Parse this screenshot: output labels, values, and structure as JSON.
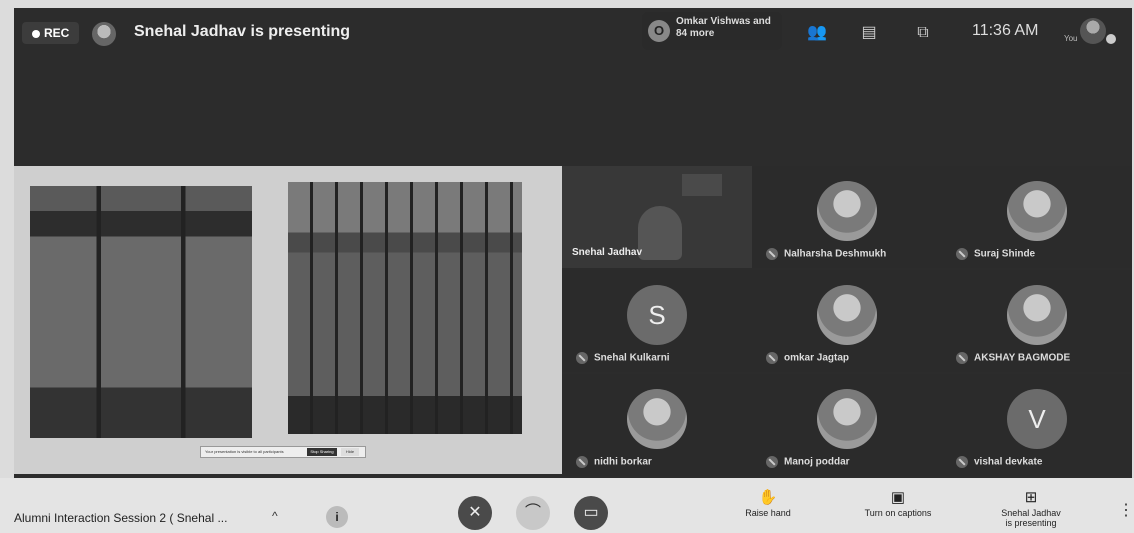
{
  "top": {
    "rec_label": "REC",
    "presenting_text": "Snehal Jadhav is presenting",
    "people_initial": "O",
    "people_text": "Omkar Vishwas and 84 more",
    "clock": "11:36 AM",
    "you_label": "You"
  },
  "shared": {
    "hint_text": "Your presentation is visible to all participants",
    "hint_btn1": "Stop Sharing",
    "hint_btn2": "Hide"
  },
  "participants": [
    {
      "name": "Snehal Jadhav"
    },
    {
      "name": "Nalharsha Deshmukh"
    },
    {
      "name": "Suraj Shinde"
    },
    {
      "name": "Snehal Kulkarni",
      "initial": "S"
    },
    {
      "name": "omkar Jagtap"
    },
    {
      "name": "AKSHAY BAGMODE"
    },
    {
      "name": "nidhi borkar"
    },
    {
      "name": "Manoj poddar"
    },
    {
      "name": "vishal devkate",
      "initial": "V"
    }
  ],
  "bottom": {
    "meeting_title": "Alumni Interaction Session 2 ( Snehal ...",
    "raise_hand": "Raise hand",
    "captions": "Turn on captions",
    "presenting_line1": "Snehal Jadhav",
    "presenting_line2": "is presenting"
  }
}
